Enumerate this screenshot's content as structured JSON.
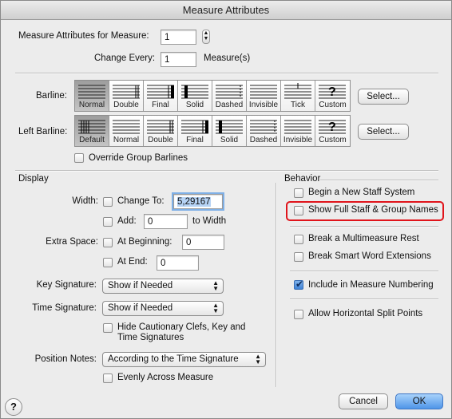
{
  "window": {
    "title": "Measure Attributes"
  },
  "top": {
    "for_label": "Measure Attributes for Measure:",
    "for_value": "1",
    "every_label": "Change Every:",
    "every_value": "1",
    "every_unit": "Measure(s)"
  },
  "barline": {
    "label": "Barline:",
    "options": [
      "Normal",
      "Double",
      "Final",
      "Solid",
      "Dashed",
      "Invisible",
      "Tick",
      "Custom"
    ],
    "selected": "Normal",
    "select_button": "Select..."
  },
  "left_barline": {
    "label": "Left Barline:",
    "options": [
      "Default",
      "Normal",
      "Double",
      "Final",
      "Solid",
      "Dashed",
      "Invisible",
      "Custom"
    ],
    "selected": "Default",
    "select_button": "Select...",
    "override_label": "Override Group Barlines",
    "override_checked": false
  },
  "display": {
    "title": "Display",
    "width_label": "Width:",
    "change_to_label": "Change To:",
    "change_to_value": "5,29167",
    "add_label": "Add:",
    "add_value": "0",
    "to_width_label": "to Width",
    "extra_space_label": "Extra Space:",
    "at_beginning_label": "At Beginning:",
    "at_beginning_value": "0",
    "at_end_label": "At End:",
    "at_end_value": "0",
    "key_sig_label": "Key Signature:",
    "key_sig_value": "Show if Needed",
    "time_sig_label": "Time Signature:",
    "time_sig_value": "Show if Needed",
    "hide_cautionary_line1": "Hide Cautionary Clefs, Key and",
    "hide_cautionary_line2": "Time Signatures",
    "position_notes_label": "Position Notes:",
    "position_notes_value": "According to the Time Signature",
    "evenly_label": "Evenly Across Measure"
  },
  "behavior": {
    "title": "Behavior",
    "items": [
      {
        "label": "Begin a New Staff System",
        "checked": false
      },
      {
        "label": "Show Full Staff & Group Names",
        "checked": false
      },
      {
        "label": "Break a Multimeasure Rest",
        "checked": false
      },
      {
        "label": "Break Smart Word Extensions",
        "checked": false
      },
      {
        "label": "Include in Measure Numbering",
        "checked": true
      },
      {
        "label": "Allow Horizontal Split Points",
        "checked": false
      }
    ]
  },
  "footer": {
    "help": "?",
    "cancel": "Cancel",
    "ok": "OK"
  },
  "colors": {
    "highlight_box": "#e0141b",
    "default_button": "#4f95e8",
    "selection": "#b6d3f5"
  },
  "icons": {
    "help": "question-mark-icon",
    "stepper": "stepper-arrows-icon",
    "popup": "popup-arrows-icon"
  }
}
